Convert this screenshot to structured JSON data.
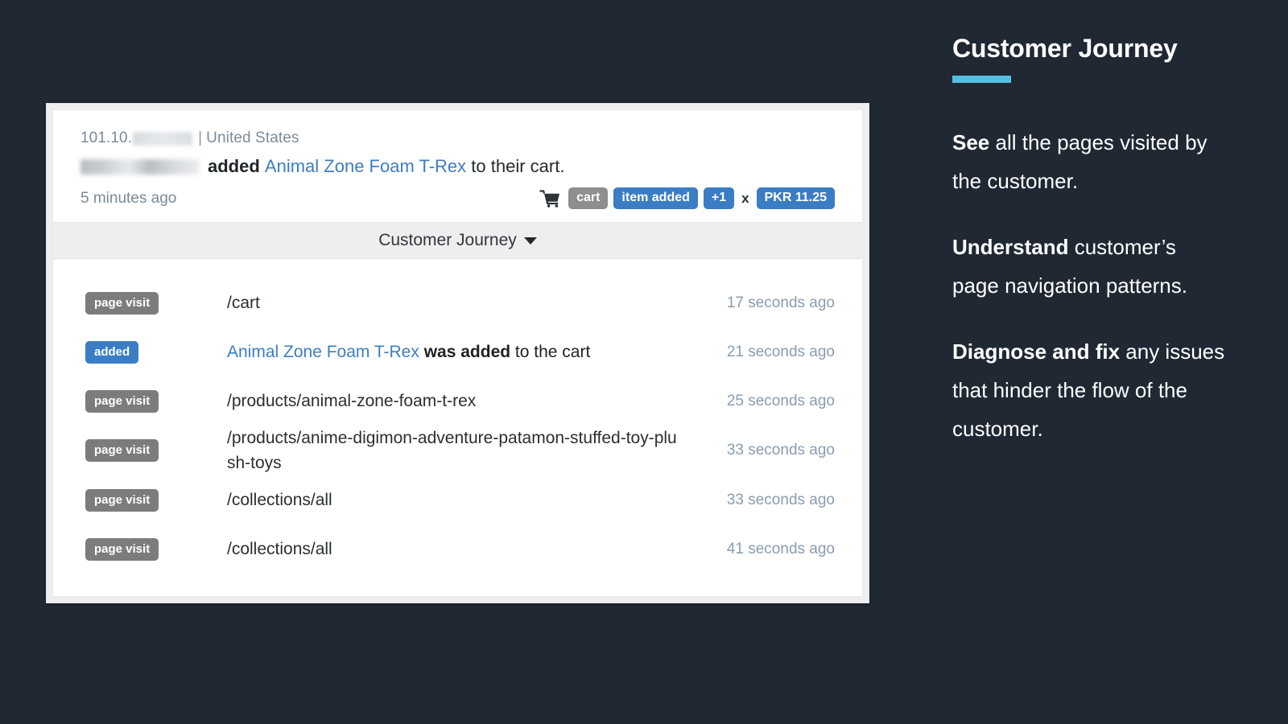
{
  "card": {
    "ip_prefix": "101.10.",
    "ip_separator": "|",
    "country": "United States",
    "action_verb": "added",
    "product_name": "Animal Zone Foam T-Rex",
    "action_tail": "to their cart.",
    "time_ago": "5 minutes ago",
    "badges": {
      "cart_icon": "shopping-cart-icon",
      "cart_label": "cart",
      "event_label": "item added",
      "quantity_label": "+1",
      "multiply_symbol": "x",
      "price_label": "PKR 11.25"
    },
    "journey_toggle": {
      "label": "Customer Journey",
      "caret_icon": "chevron-down-icon"
    },
    "journey_rows": [
      {
        "badge": "page visit",
        "badge_type": "gray",
        "text": "/cart",
        "link_text": "",
        "time": "17 seconds ago"
      },
      {
        "badge": "added",
        "badge_type": "blue",
        "text": " was added to the cart",
        "link_text": "Animal Zone Foam T-Rex",
        "time": "21 seconds ago"
      },
      {
        "badge": "page visit",
        "badge_type": "gray",
        "text": "/products/animal-zone-foam-t-rex",
        "link_text": "",
        "time": "25 seconds ago"
      },
      {
        "badge": "page visit",
        "badge_type": "gray",
        "text": "/products/anime-digimon-adventure-patamon-stuffed-toy-plush-toys",
        "link_text": "",
        "time": "33 seconds ago"
      },
      {
        "badge": "page visit",
        "badge_type": "gray",
        "text": "/collections/all",
        "link_text": "",
        "time": "33 seconds ago"
      },
      {
        "badge": "page visit",
        "badge_type": "gray",
        "text": "/collections/all",
        "link_text": "",
        "time": "41 seconds ago"
      }
    ]
  },
  "promo": {
    "title": "Customer Journey",
    "accent_color": "#56bfe0",
    "paragraphs": [
      {
        "lead": "See",
        "rest": " all the pages visited by the customer."
      },
      {
        "lead": "Understand",
        "rest": " customer’s page navigation patterns."
      },
      {
        "lead": "Diagnose and fix",
        "rest": " any issues that hinder the flow of the customer."
      }
    ]
  },
  "colors": {
    "background": "#1f2833",
    "accent": "#56bfe0",
    "badge_blue": "#3b7dc4",
    "badge_gray": "#7c7c7c",
    "link_blue": "#3e7ec0",
    "timestamp": "#8a9cb0"
  }
}
